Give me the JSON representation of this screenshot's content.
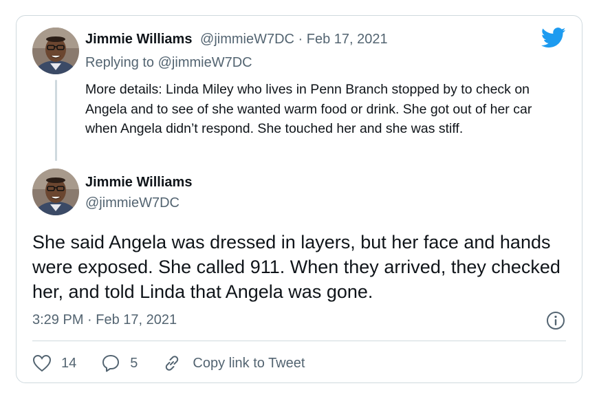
{
  "quoted_tweet": {
    "author_name": "Jimmie Williams",
    "handle": "@jimmieW7DC",
    "separator": "·",
    "date": "Feb 17, 2021",
    "replying_prefix": "Replying to",
    "replying_to": "@jimmieW7DC",
    "text": "More details: Linda Miley who lives in Penn Branch stopped by to check on Angela and to see of she wanted warm food or drink.  She got out of her car when Angela didn’t respond. She touched her and she was stiff."
  },
  "main_tweet": {
    "author_name": "Jimmie Williams",
    "handle": "@jimmieW7DC",
    "text": "She said Angela was dressed in layers, but her face and hands were exposed. She called 911.  When they arrived, they checked her, and told Linda that Angela was gone.",
    "timestamp": "3:29 PM · Feb 17, 2021"
  },
  "actions": {
    "like_count": "14",
    "reply_count": "5",
    "copy_link_label": "Copy link to Tweet"
  },
  "colors": {
    "twitter_blue": "#1d9bf0",
    "muted_text": "#536471",
    "border": "#cfd9de"
  },
  "icons": [
    "twitter-logo-icon",
    "info-icon",
    "heart-icon",
    "reply-bubble-icon",
    "link-icon"
  ]
}
